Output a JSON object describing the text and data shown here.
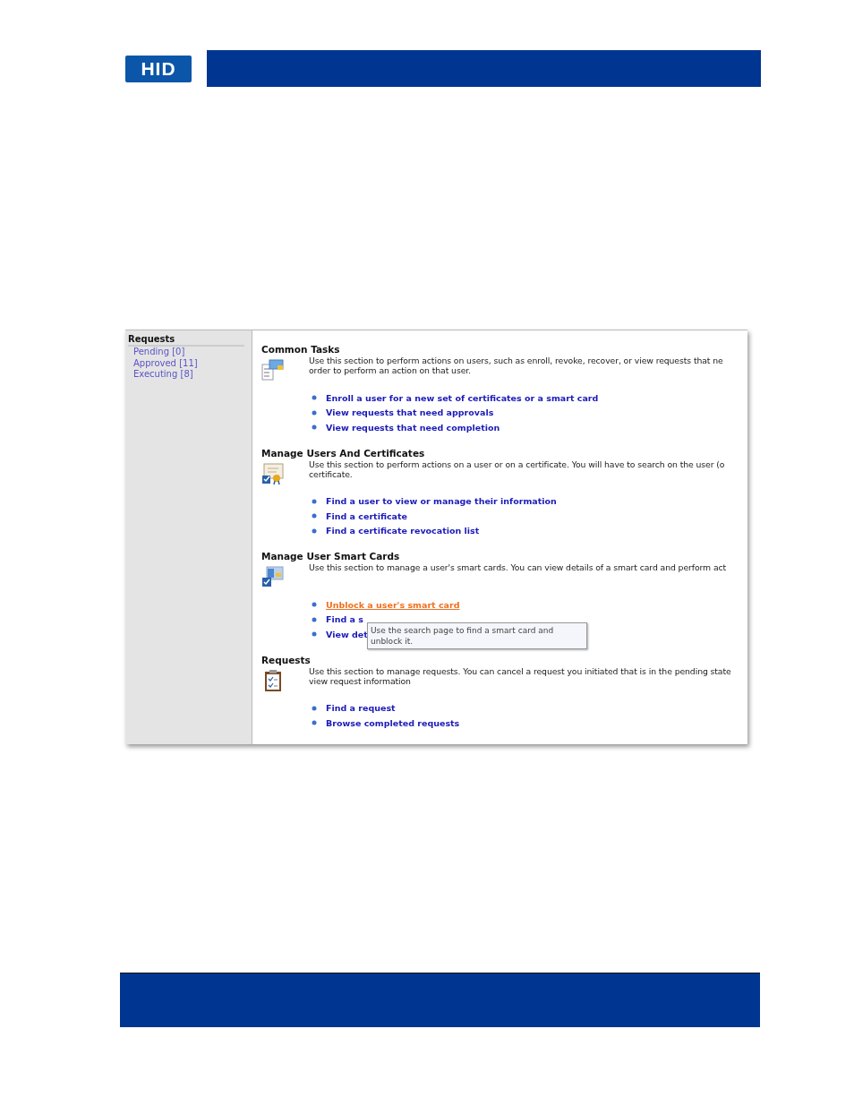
{
  "header": {
    "logo": "HID"
  },
  "sidebar": {
    "heading": "Requests",
    "items": [
      {
        "label": "Pending [0]"
      },
      {
        "label": "Approved [11]"
      },
      {
        "label": "Executing [8]"
      }
    ]
  },
  "sections": [
    {
      "kind": "tasks",
      "title": "Common Tasks",
      "description_lines": [
        "Use this section to perform actions on users, such as enroll, revoke, recover, or view requests that ne",
        "order to perform an action on that user."
      ],
      "links": [
        {
          "label": "Enroll a user for a new set of certificates or a smart card",
          "hovered": false
        },
        {
          "label": "View requests that need approvals",
          "hovered": false
        },
        {
          "label": "View requests that need completion",
          "hovered": false
        }
      ]
    },
    {
      "kind": "certificate",
      "title": "Manage Users And Certificates",
      "description_lines": [
        "Use this section to perform actions on a user or on a certificate. You will have to search on the user (o",
        "certificate."
      ],
      "links": [
        {
          "label": "Find a user to view or manage their information",
          "hovered": false
        },
        {
          "label": "Find a certificate",
          "hovered": false
        },
        {
          "label": "Find a certificate revocation list",
          "hovered": false
        }
      ]
    },
    {
      "kind": "smartcard",
      "title": "Manage User Smart Cards",
      "description_lines": [
        "Use this section to manage a user's smart cards. You can view details of a smart card and perform act"
      ],
      "links": [
        {
          "label": "Unblock a user's smart card",
          "hovered": true
        },
        {
          "label": "Find a s",
          "hovered": false
        },
        {
          "label": "View det",
          "hovered": false
        }
      ],
      "tooltip": "Use the search page to find a smart card and unblock it."
    },
    {
      "kind": "clipboard",
      "title": "Requests",
      "description_lines": [
        "Use this section to manage requests. You can cancel a request you initiated that is in the pending state",
        "view request information"
      ],
      "links": [
        {
          "label": "Find a request",
          "hovered": false
        },
        {
          "label": "Browse completed requests",
          "hovered": false
        }
      ]
    }
  ]
}
